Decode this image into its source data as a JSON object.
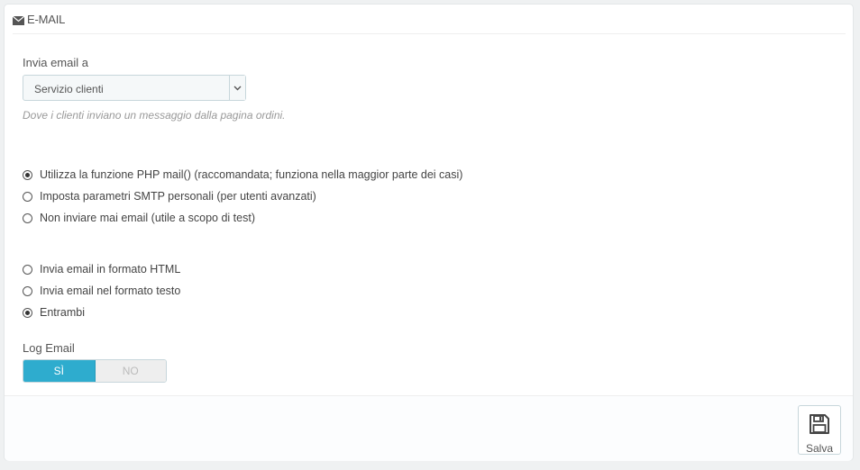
{
  "panel": {
    "heading": "E-MAIL",
    "heading_icon": "envelope-icon"
  },
  "email_to": {
    "label": "Invia email a",
    "selected": "Servizio clienti",
    "help": "Dove i clienti inviano un messaggio dalla pagina ordini."
  },
  "mail_method": {
    "options": [
      {
        "label": "Utilizza la funzione PHP mail() (raccomandata; funziona nella maggior parte dei casi)",
        "checked": true
      },
      {
        "label": "Imposta parametri SMTP personali (per utenti avanzati)",
        "checked": false
      },
      {
        "label": "Non inviare mai email (utile a scopo di test)",
        "checked": false
      }
    ]
  },
  "mail_format": {
    "options": [
      {
        "label": "Invia email in formato HTML",
        "checked": false
      },
      {
        "label": "Invia email nel formato testo",
        "checked": false
      },
      {
        "label": "Entrambi",
        "checked": true
      }
    ]
  },
  "log_email": {
    "label": "Log Email",
    "yes": "SÌ",
    "no": "NO",
    "value": "yes"
  },
  "footer": {
    "save_label": "Salva",
    "save_icon": "floppy-disk-icon"
  },
  "colors": {
    "accent": "#2eacce",
    "border": "#c7d6db",
    "background": "#eff1f2"
  }
}
